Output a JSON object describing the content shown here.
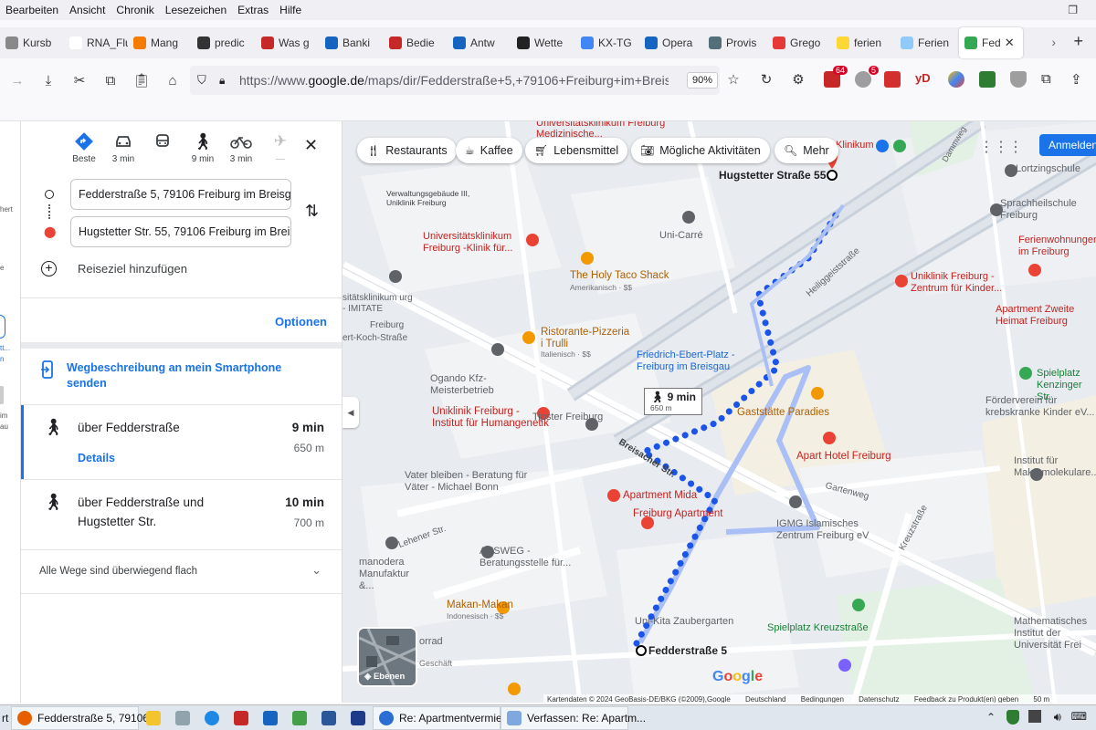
{
  "menu": [
    "Bearbeiten",
    "Ansicht",
    "Chronik",
    "Lesezeichen",
    "Extras",
    "Hilfe"
  ],
  "tabs": [
    {
      "label": "Kursb",
      "color": "#888888"
    },
    {
      "label": "RNA_Flug",
      "color": "#ffffff"
    },
    {
      "label": "Mang",
      "color": "#f57c00"
    },
    {
      "label": "predic",
      "color": "#333333"
    },
    {
      "label": "Was g",
      "color": "#c62828"
    },
    {
      "label": "Banki",
      "color": "#1565c0"
    },
    {
      "label": "Bedie",
      "color": "#c62828"
    },
    {
      "label": "Antw",
      "color": "#1565c0"
    },
    {
      "label": "Wette",
      "color": "#222222"
    },
    {
      "label": "KX-TG",
      "color": "#4285f4"
    },
    {
      "label": "Opera",
      "color": "#1565c0"
    },
    {
      "label": "Provis",
      "color": "#546e7a"
    },
    {
      "label": "Grego",
      "color": "#e53935"
    },
    {
      "label": "ferien",
      "color": "#fdd835"
    },
    {
      "label": "Ferien",
      "color": "#90caf9"
    },
    {
      "label": "Fed",
      "color": "#34a853",
      "active": true
    }
  ],
  "nav": {
    "url_prefix": "https://www.",
    "url_domain": "google.de",
    "url_path": "/maps/dir/Fedderstraße+5,+79106+Freiburg+im+Breisgau",
    "zoom": "90%",
    "badge1": "64",
    "badge2": "5",
    "yd": "yD"
  },
  "leftstrip": [
    "hert",
    "e",
    "tt...",
    "n",
    "im",
    "au"
  ],
  "panel": {
    "modes": [
      {
        "label": "Beste",
        "icon": "directions-icon"
      },
      {
        "label": "3 min",
        "icon": "car-icon"
      },
      {
        "label": "",
        "icon": "transit-icon"
      },
      {
        "label": "9 min",
        "icon": "walk-icon"
      },
      {
        "label": "3 min",
        "icon": "bike-icon"
      },
      {
        "label": "—",
        "icon": "flight-icon"
      }
    ],
    "origin": "Fedderstraße 5, 79106 Freiburg im Breisgau",
    "destination": "Hugstetter Str. 55, 79106 Freiburg im Breisgau",
    "add_stop": "Reiseziel hinzufügen",
    "options": "Optionen",
    "send_to_phone": "Wegbeschreibung an mein Smartphone senden",
    "routes": [
      {
        "name": "über Fedderstraße",
        "time": "9 min",
        "dist": "650 m",
        "details": "Details"
      },
      {
        "name": "über Fedderstraße und Hugstetter Str.",
        "time": "10 min",
        "dist": "700 m"
      }
    ],
    "flat_note": "Alle Wege sind überwiegend flach"
  },
  "map": {
    "chips": [
      {
        "label": "Restaurants",
        "icon": "fork-icon"
      },
      {
        "label": "Kaffee",
        "icon": "coffee-icon"
      },
      {
        "label": "Lebensmittel",
        "icon": "cart-icon"
      },
      {
        "label": "Mögliche Aktivitäten",
        "icon": "camera-icon"
      },
      {
        "label": "Mehr",
        "icon": "search-icon"
      }
    ],
    "signin": "Anmelden",
    "layers_label": "Ebenen",
    "route_label_time": "9 min",
    "route_label_dist": "650 m",
    "dest_label": "Hugstetter Straße 55",
    "origin_label": "Fedderstraße 5",
    "labels": [
      "Universitätsklinikum Freiburg Medizinische...",
      "Klinikum",
      "Verwaltungsgebäude III, Uniklinik Freiburg",
      "Lortzingschule",
      "Sprachheilschule Freiburg",
      "Uni-Carré",
      "Universitätsklinikum Freiburg -Klinik für...",
      "Ferienwohnungen im Freiburg",
      "The Holy Taco Shack",
      "Amerikanisch · $$",
      "Uniklinik Freiburg - Zentrum für Kinder...",
      "sitätsklinikum urg - IMITATE",
      "Apartment Zweite Heimat Freiburg",
      "Ristorante-Pizzeria i Trulli",
      "Italienisch · $$",
      "Friedrich-Ebert-Platz - Freiburg im Breisgau",
      "Spielplatz Kenzinger Str.",
      "Ogando Kfz-Meisterbetrieb",
      "Förderverein für krebskranke Kinder eV...",
      "Uniklinik Freiburg - Institut für Humangenetik",
      "Gaststätte Paradies",
      "Tipster Freiburg",
      "Apart Hotel Freiburg",
      "Vater bleiben - Beratung für Väter - Michael Bonn",
      "Institut für Makromolekulare...",
      "Apartment Mida",
      "Freiburg Apartment",
      "IGMG Islamisches Zentrum Freiburg eV",
      "AUSWEG - Beratungsstelle für...",
      "manodera Manufaktur &...",
      "Makan-Makan",
      "Indonesisch · $$",
      "Uni-Kita Zaubergarten",
      "Spielplatz Kreuzstraße",
      "Mathematisches Institut der Universität Frei",
      "orrad",
      "Geschäft",
      "ert-Koch-Straße",
      "Freiburg"
    ],
    "streets": [
      "Heiliggeiststraße",
      "Breisacher Str.",
      "Lehener Str.",
      "Gartenweg",
      "Kreuzstraße",
      "Dammweg"
    ],
    "footer": [
      "Kartendaten © 2024 GeoBasis-DE/BKG (©2009),Google",
      "Deutschland",
      "Bedingungen",
      "Datenschutz",
      "Feedback zu Produkt(en) geben",
      "50 m"
    ],
    "google": "Google"
  },
  "taskbar": {
    "items": [
      {
        "label": "Fedderstraße 5, 79106...",
        "color": "#e66000",
        "wide": true
      },
      {
        "label": "Re: Apartmentvermiet...",
        "color": "#2a6ed4",
        "wide": true
      },
      {
        "label": "Verfassen: Re: Apartm...",
        "color": "#2a6ed4",
        "wide": true
      }
    ]
  },
  "colors": {
    "accent": "#1a73e8",
    "route": "#1a54e8",
    "route_alt": "#aabff5",
    "pin": "#ea4335"
  }
}
